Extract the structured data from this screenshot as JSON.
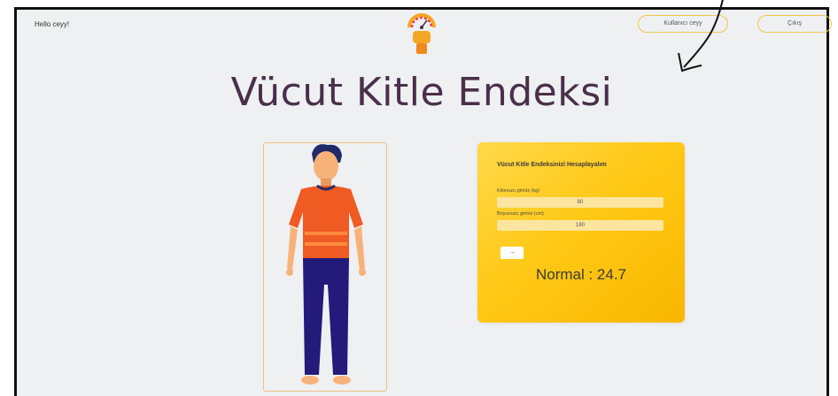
{
  "header": {
    "greeting": "Hello ceyy!",
    "user_button": "Kullanıcı ceyy",
    "exit_button": "Çıkış"
  },
  "page": {
    "title": "Vücut Kitle Endeksi"
  },
  "calculator": {
    "heading": "Vücut Kitle Endeksinizi Hesaplayalım",
    "weight_label": "Kilonuzu giriniz (kg)",
    "weight_value": "80",
    "height_label": "Boyunuzu giriniz (cm)",
    "height_value": "180",
    "submit_label": "→",
    "result": "Normal : 24.7"
  },
  "colors": {
    "accent": "#ffc917",
    "title": "#4a2f4a",
    "shirt": "#f05a23",
    "pants": "#241a7a"
  },
  "icons": {
    "logo": "gauge-person-icon"
  }
}
